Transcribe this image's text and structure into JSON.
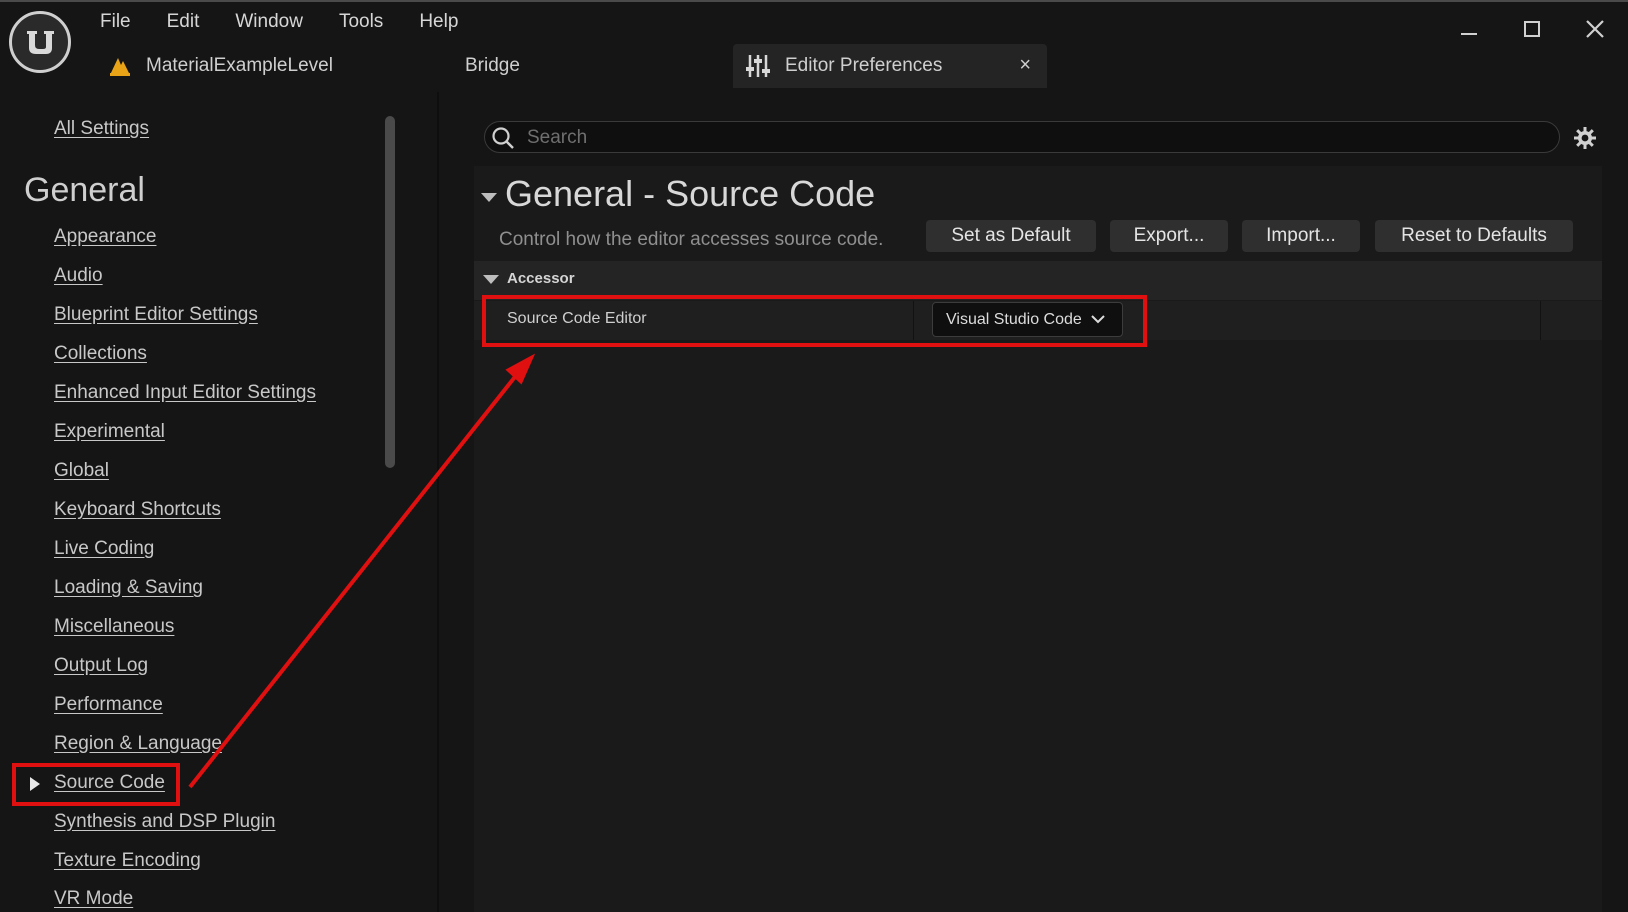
{
  "menu": [
    "File",
    "Edit",
    "Window",
    "Tools",
    "Help"
  ],
  "tabs": {
    "level": "MaterialExampleLevel",
    "bridge": "Bridge",
    "prefs": "Editor Preferences",
    "close": "×"
  },
  "sidebar": {
    "all_settings": "All Settings",
    "heading": "General",
    "items": [
      "Appearance",
      "Audio",
      "Blueprint Editor Settings",
      "Collections",
      "Enhanced Input Editor Settings",
      "Experimental",
      "Global",
      "Keyboard Shortcuts",
      "Live Coding",
      "Loading & Saving",
      "Miscellaneous",
      "Output Log",
      "Performance",
      "Region & Language",
      "Source Code",
      "Synthesis and DSP Plugin",
      "Texture Encoding",
      "VR Mode"
    ],
    "selected": "Source Code"
  },
  "search": {
    "placeholder": "Search"
  },
  "section": {
    "title": "General - Source Code",
    "description": "Control how the editor accesses source code."
  },
  "buttons": {
    "set_default": "Set as Default",
    "export": "Export...",
    "import": "Import...",
    "reset": "Reset to Defaults"
  },
  "category": "Accessor",
  "property": {
    "label": "Source Code Editor",
    "value": "Visual Studio Code"
  },
  "colors": {
    "background": "#151515",
    "panel": "#1a1a1a",
    "annotation": "#e01010",
    "level_icon": "#e8a317"
  },
  "icons": [
    "unreal-logo-icon",
    "level-icon",
    "sliders-icon",
    "close-icon",
    "minimize-icon",
    "maximize-icon",
    "search-icon",
    "gear-icon",
    "chevron-down-icon"
  ]
}
